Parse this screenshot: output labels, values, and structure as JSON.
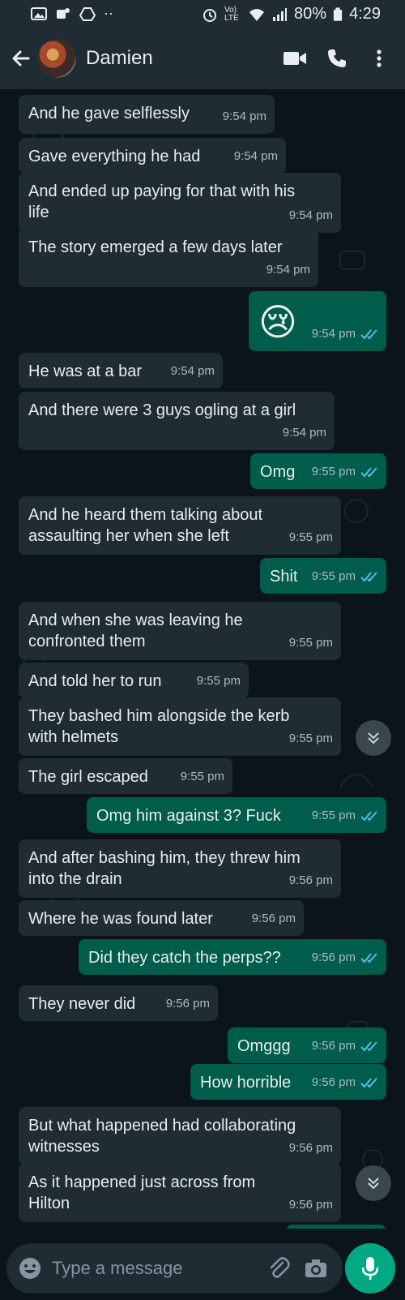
{
  "status_bar": {
    "battery": "80%",
    "time": "4:29",
    "network": "Vo) LTE"
  },
  "header": {
    "contact_name": "Damien"
  },
  "messages": [
    {
      "dir": "in",
      "text": "And he gave selflessly",
      "time": "9:54 pm"
    },
    {
      "dir": "in",
      "text": "Gave everything he had",
      "time": "9:54 pm"
    },
    {
      "dir": "in",
      "text": "And ended up paying for that with his\nlife",
      "time": "9:54 pm"
    },
    {
      "dir": "in",
      "text": "The story emerged a few days later",
      "time": "9:54 pm"
    },
    {
      "dir": "out",
      "text": "😢",
      "time": "9:54 pm",
      "read": true
    },
    {
      "dir": "in",
      "text": "He was at a bar",
      "time": "9:54 pm"
    },
    {
      "dir": "in",
      "text": "And there were 3 guys ogling at a girl",
      "time": "9:54 pm"
    },
    {
      "dir": "out",
      "text": "Omg",
      "time": "9:55 pm",
      "read": true
    },
    {
      "dir": "in",
      "text": "And he heard them talking about\nassaulting her when she left",
      "time": "9:55 pm"
    },
    {
      "dir": "out",
      "text": "Shit",
      "time": "9:55 pm",
      "read": true
    },
    {
      "dir": "in",
      "text": "And when she was leaving he\nconfronted them",
      "time": "9:55 pm"
    },
    {
      "dir": "in",
      "text": "And told her to run",
      "time": "9:55 pm"
    },
    {
      "dir": "in",
      "text": "They bashed him alongside the kerb\nwith helmets",
      "time": "9:55 pm"
    },
    {
      "dir": "in",
      "text": "The girl escaped",
      "time": "9:55 pm"
    },
    {
      "dir": "out",
      "text": "Omg him against 3? Fuck",
      "time": "9:55 pm",
      "read": true
    },
    {
      "dir": "in",
      "text": "And after bashing him, they threw him\ninto the drain",
      "time": "9:56 pm"
    },
    {
      "dir": "in",
      "text": "Where he was found later",
      "time": "9:56 pm"
    },
    {
      "dir": "out",
      "text": "Did they catch the perps??",
      "time": "9:56 pm",
      "read": true
    },
    {
      "dir": "in",
      "text": "They never did",
      "time": "9:56 pm"
    },
    {
      "dir": "out",
      "text": "Omggg",
      "time": "9:56 pm",
      "read": true
    },
    {
      "dir": "out",
      "text": "How horrible",
      "time": "9:56 pm",
      "read": true
    },
    {
      "dir": "in",
      "text": "But what happened had collaborating\nwitnesses",
      "time": "9:56 pm"
    },
    {
      "dir": "in",
      "text": "As it happened just across from\nHilton",
      "time": "9:56 pm"
    }
  ],
  "composer": {
    "placeholder": "Type a message"
  }
}
